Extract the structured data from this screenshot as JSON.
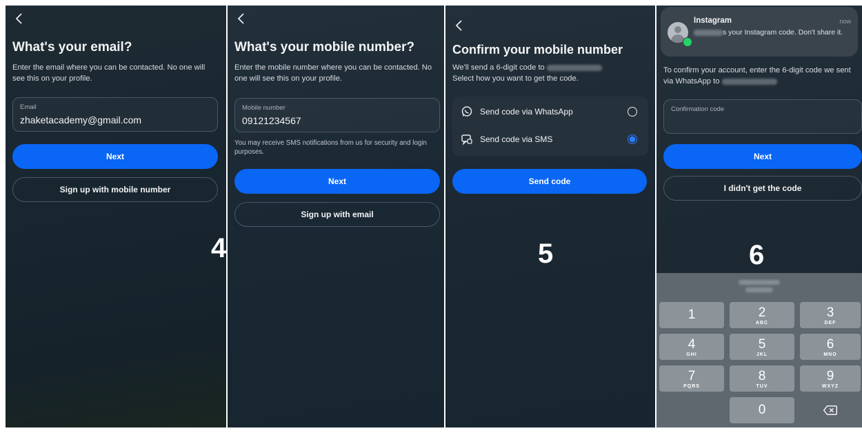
{
  "screen1": {
    "title": "What's your email?",
    "description": "Enter the email where you can be contacted. No one will see this on your profile.",
    "field_label": "Email",
    "field_value": "zhaketacademy@gmail.com",
    "next_label": "Next",
    "alt_label": "Sign up with mobile number",
    "step": "4"
  },
  "screen2": {
    "title": "What's your mobile number?",
    "description": "Enter the mobile number where you can be contacted. No one will see this on your profile.",
    "field_label": "Mobile number",
    "field_value": "09121234567",
    "notice": "You may receive SMS notifications from us for security and login purposes.",
    "next_label": "Next",
    "alt_label": "Sign up with email"
  },
  "screen3": {
    "title": "Confirm your mobile number",
    "description_prefix": "We'll send a 6-digit code to",
    "description_suffix": "Select how you want to get the code.",
    "options": [
      {
        "label": "Send code via WhatsApp",
        "icon": "whatsapp-icon",
        "selected": false
      },
      {
        "label": "Send code via SMS",
        "icon": "sms-icon",
        "selected": true
      }
    ],
    "send_label": "Send code",
    "step": "5"
  },
  "screen4": {
    "notification": {
      "app": "Instagram",
      "time": "now",
      "message_suffix": "s your Instagram code. Don't share it."
    },
    "description_prefix": "To confirm your account, enter the 6-digit code we sent via WhatsApp to",
    "field_label": "Confirmation code",
    "next_label": "Next",
    "alt_label": "I didn't get the code",
    "step": "6",
    "keys": [
      {
        "digit": "1",
        "letters": ""
      },
      {
        "digit": "2",
        "letters": "ABC"
      },
      {
        "digit": "3",
        "letters": "DEF"
      },
      {
        "digit": "4",
        "letters": "GHI"
      },
      {
        "digit": "5",
        "letters": "JKL"
      },
      {
        "digit": "6",
        "letters": "MNO"
      },
      {
        "digit": "7",
        "letters": "PQRS"
      },
      {
        "digit": "8",
        "letters": "TUV"
      },
      {
        "digit": "9",
        "letters": "WXYZ"
      },
      {
        "digit": "0",
        "letters": ""
      }
    ]
  },
  "colors": {
    "primary": "#0a66f5",
    "background": "#1b2832",
    "radio_selected": "#2a7bff",
    "keypad": "#5f676f"
  }
}
